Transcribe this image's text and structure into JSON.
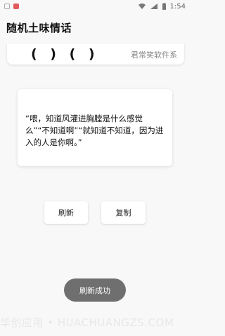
{
  "status_bar": {
    "time": "1:54",
    "icons": [
      "notification-icon",
      "alert-icon",
      "wifi-icon",
      "signal-icon",
      "battery-icon"
    ]
  },
  "app_bar": {
    "title": "随机土味情话"
  },
  "banner": {
    "glyphs": "( ) ( )",
    "text": "君常笑软件系"
  },
  "quote": {
    "text": "“喂，知道风灌进胸膛是什么感觉么”“不知道啊”“就知道不知道，因为进入的人是你啊。”"
  },
  "buttons": {
    "refresh_label": "刷新",
    "copy_label": "复制"
  },
  "toast": {
    "text": "刷新成功"
  },
  "watermark": {
    "text": "华创应用 • HUACHUANGZS.COM"
  }
}
